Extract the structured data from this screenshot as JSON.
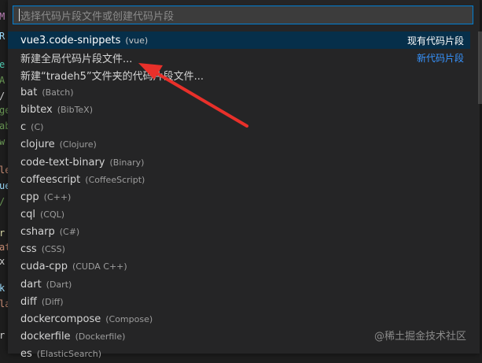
{
  "search": {
    "placeholder": "选择代码片段文件或创建代码片段"
  },
  "editor_fragments": [
    "M",
    "R",
    "e",
    "A",
    "/",
    "ge",
    "ab",
    "w",
    "le",
    "ue",
    "/",
    "r",
    "at",
    "x",
    "k",
    "la",
    "r"
  ],
  "items": [
    {
      "label": "vue3.code-snippets",
      "desc": "(vue)",
      "right": "现有代码片段",
      "selected": true
    },
    {
      "label": "新建全局代码片段文件...",
      "desc": "",
      "right": "新代码片段"
    },
    {
      "label": "新建“tradeh5”文件夹的代码片段文件...",
      "desc": "",
      "right": ""
    },
    {
      "label": "bat",
      "desc": "(Batch)",
      "right": ""
    },
    {
      "label": "bibtex",
      "desc": "(BibTeX)",
      "right": ""
    },
    {
      "label": "c",
      "desc": "(C)",
      "right": ""
    },
    {
      "label": "clojure",
      "desc": "(Clojure)",
      "right": ""
    },
    {
      "label": "code-text-binary",
      "desc": "(Binary)",
      "right": ""
    },
    {
      "label": "coffeescript",
      "desc": "(CoffeeScript)",
      "right": ""
    },
    {
      "label": "cpp",
      "desc": "(C++)",
      "right": ""
    },
    {
      "label": "cql",
      "desc": "(CQL)",
      "right": ""
    },
    {
      "label": "csharp",
      "desc": "(C#)",
      "right": ""
    },
    {
      "label": "css",
      "desc": "(CSS)",
      "right": ""
    },
    {
      "label": "cuda-cpp",
      "desc": "(CUDA C++)",
      "right": ""
    },
    {
      "label": "dart",
      "desc": "(Dart)",
      "right": ""
    },
    {
      "label": "diff",
      "desc": "(Diff)",
      "right": ""
    },
    {
      "label": "dockercompose",
      "desc": "(Compose)",
      "right": ""
    },
    {
      "label": "dockerfile",
      "desc": "(Dockerfile)",
      "right": ""
    },
    {
      "label": "es",
      "desc": "(ElasticSearch)",
      "right": ""
    }
  ],
  "watermark": "@稀土掘金技术社区",
  "colors": {
    "accent": "#007fd4",
    "selected_bg": "#062f4a",
    "link": "#3794ff",
    "arrow": "#e8302a"
  }
}
